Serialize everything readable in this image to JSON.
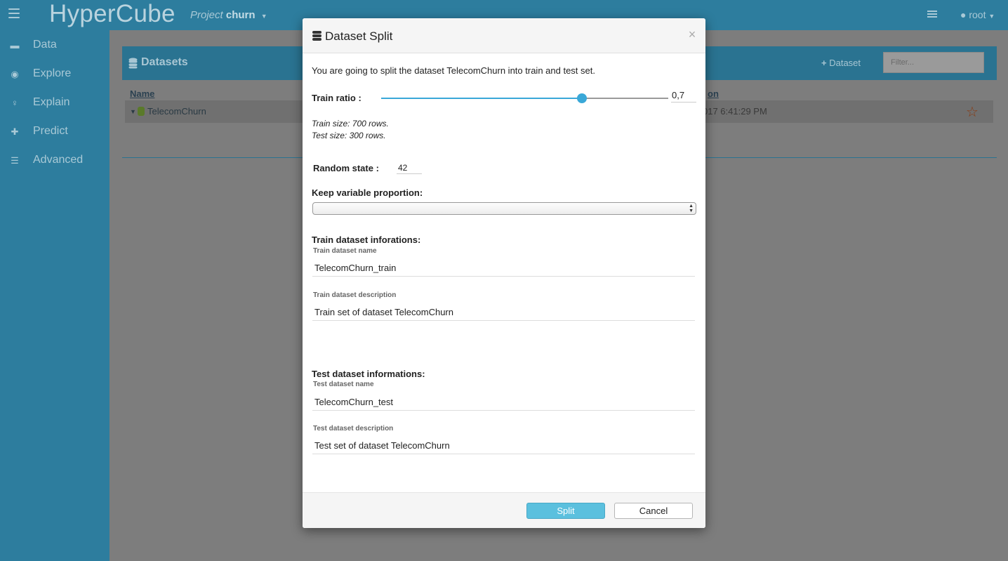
{
  "app": {
    "brand": "HyperCube",
    "project_label": "Project",
    "project_name": "churn",
    "user": "root"
  },
  "sidebar": {
    "items": [
      {
        "label": "Data",
        "icon": "archive-icon"
      },
      {
        "label": "Explore",
        "icon": "eye-icon"
      },
      {
        "label": "Explain",
        "icon": "lightbulb-icon"
      },
      {
        "label": "Predict",
        "icon": "puzzle-icon"
      },
      {
        "label": "Advanced",
        "icon": "sliders-icon"
      }
    ]
  },
  "datasets_panel": {
    "title": "Datasets",
    "add_label": "Dataset",
    "filter_placeholder": "Filter...",
    "col_name": "Name",
    "col_created": "on",
    "row": {
      "name": "TelecomChurn",
      "date": "017 6:41:29 PM"
    }
  },
  "modal": {
    "title": "Dataset Split",
    "intro": "You are going to split the dataset TelecomChurn into train and test set.",
    "train_ratio_label": "Train ratio :",
    "train_ratio_value": "0,7",
    "train_ratio": 0.7,
    "train_size": "Train size: 700 rows.",
    "test_size": "Test size: 300 rows.",
    "random_state_label": "Random state :",
    "random_state_value": "42",
    "keep_proportion_label": "Keep variable proportion:",
    "keep_proportion_value": "",
    "train_section": "Train dataset inforations:",
    "train_name_label": "Train dataset name",
    "train_name_value": "TelecomChurn_train",
    "train_desc_label": "Train dataset description",
    "train_desc_value": "Train set of dataset TelecomChurn",
    "test_section": "Test dataset informations:",
    "test_name_label": "Test dataset name",
    "test_name_value": "TelecomChurn_test",
    "test_desc_label": "Test dataset description",
    "test_desc_value": "Test set of dataset TelecomChurn",
    "split_label": "Split",
    "cancel_label": "Cancel"
  },
  "colors": {
    "nav_bg": "#2d7d9e",
    "accent": "#3aa8d8",
    "split_button": "#5bc0de"
  }
}
